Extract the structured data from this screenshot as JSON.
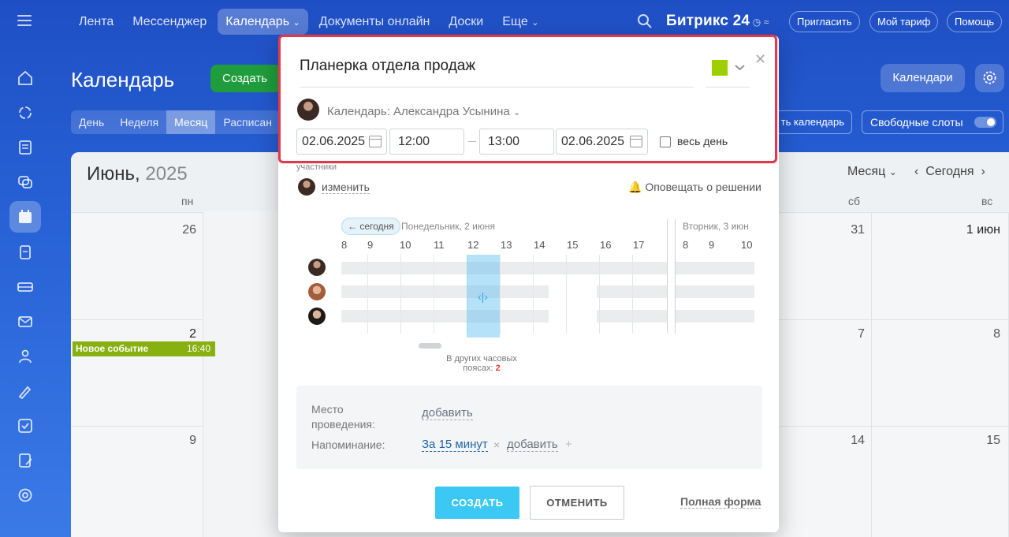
{
  "topnav": {
    "items": [
      "Лента",
      "Мессенджер",
      "Календарь",
      "Документы онлайн",
      "Доски",
      "Еще"
    ],
    "brand": "Битрикс",
    "brand_num": "24",
    "invite": "Пригласить",
    "tariff": "Мой тариф",
    "help": "Помощь"
  },
  "page": {
    "title": "Календарь",
    "create_label": "Создать",
    "calendars_label": "Календари",
    "view_tabs": [
      "День",
      "Неделя",
      "Месяц",
      "Расписан"
    ],
    "sync_label": "ть календарь",
    "slots_label": "Свободные слоты"
  },
  "calendar": {
    "month": "Июнь,",
    "year": "2025",
    "month_select": "Месяц",
    "today": "Сегодня",
    "dow": [
      "пн",
      "сб",
      "вс"
    ],
    "row1": [
      "26",
      "31",
      "1 июн"
    ],
    "row2": [
      "2",
      "7",
      "8"
    ],
    "row3": [
      "9",
      "14",
      "15"
    ],
    "event": {
      "title": "Новое событие",
      "time": "16:40",
      "color": "#88b010"
    }
  },
  "modal": {
    "title": "Планерка отдела продаж",
    "color": "#9fce00",
    "calendar_owner": "Календарь: Александра Усынина",
    "date_from": "02.06.2025",
    "time_from": "12:00",
    "time_to": "13:00",
    "date_to": "02.06.2025",
    "allday_label": "весь день",
    "participants_label": "участники",
    "change_label": "изменить",
    "notify_label": "Оповещать о решении",
    "today_chip": "← сегодня",
    "day1_label": "Понедельник, 2 июня",
    "day2_label": "Вторник, 3 июн",
    "hours_day1": [
      "8",
      "9",
      "10",
      "11",
      "12",
      "13",
      "14",
      "15",
      "16",
      "17"
    ],
    "hours_day2": [
      "8",
      "9",
      "10"
    ],
    "tz_note": "В других часовых поясах:",
    "tz_count": "2",
    "place_label": "Место проведения:",
    "place_link": "добавить",
    "reminder_label": "Напоминание:",
    "reminder_value": "За 15 минут",
    "reminder_add": "добавить",
    "create_btn": "СОЗДАТЬ",
    "cancel_btn": "ОТМЕНИТЬ",
    "full_form": "Полная форма"
  }
}
